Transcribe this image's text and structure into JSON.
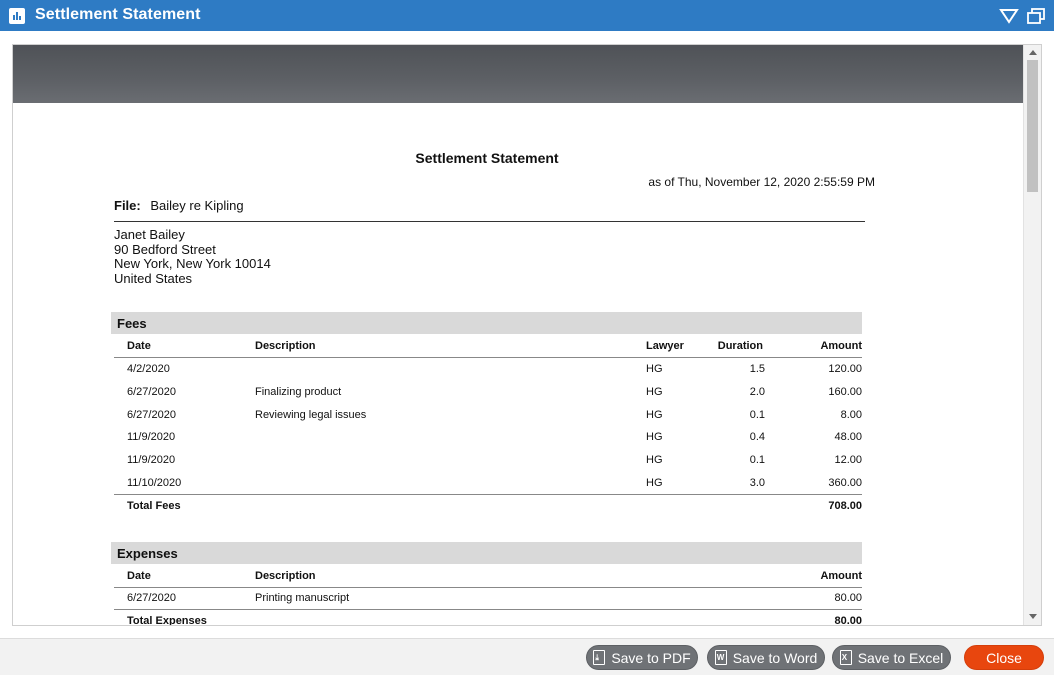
{
  "window": {
    "title": "Settlement Statement"
  },
  "report": {
    "title": "Settlement Statement",
    "as_of": "as of Thu, November 12, 2020  2:55:59 PM",
    "file_label": "File:",
    "file_value": "Bailey re Kipling",
    "address": [
      "Janet Bailey",
      "90 Bedford Street",
      "New York, New York 10014",
      "United States"
    ]
  },
  "fees": {
    "heading": "Fees",
    "columns": {
      "date": "Date",
      "description": "Description",
      "lawyer": "Lawyer",
      "duration": "Duration",
      "amount": "Amount"
    },
    "rows": [
      {
        "date": "4/2/2020",
        "description": "",
        "lawyer": "HG",
        "duration": "1.5",
        "amount": "120.00"
      },
      {
        "date": "6/27/2020",
        "description": "Finalizing product",
        "lawyer": "HG",
        "duration": "2.0",
        "amount": "160.00"
      },
      {
        "date": "6/27/2020",
        "description": "Reviewing legal issues",
        "lawyer": "HG",
        "duration": "0.1",
        "amount": "8.00"
      },
      {
        "date": "11/9/2020",
        "description": "",
        "lawyer": "HG",
        "duration": "0.4",
        "amount": "48.00"
      },
      {
        "date": "11/9/2020",
        "description": "",
        "lawyer": "HG",
        "duration": "0.1",
        "amount": "12.00"
      },
      {
        "date": "11/10/2020",
        "description": "",
        "lawyer": "HG",
        "duration": "3.0",
        "amount": "360.00"
      }
    ],
    "total_label": "Total Fees",
    "total_value": "708.00"
  },
  "expenses": {
    "heading": "Expenses",
    "columns": {
      "date": "Date",
      "description": "Description",
      "amount": "Amount"
    },
    "rows": [
      {
        "date": "6/27/2020",
        "description": "Printing manuscript",
        "amount": "80.00"
      }
    ],
    "total_label": "Total Expenses",
    "total_value": "80.00"
  },
  "footer": {
    "save_pdf": "Save to PDF",
    "save_word": "Save to Word",
    "save_excel": "Save to Excel",
    "close": "Close"
  },
  "icons": {
    "app": "report-chart-icon",
    "collapse": "triangle-down-icon",
    "restore": "restore-window-icon",
    "pdf": "pdf-file-icon",
    "word": "word-file-icon",
    "excel": "excel-file-icon"
  },
  "colors": {
    "titlebar": "#2e7bc4",
    "close_button": "#e8460e",
    "footer_button": "#6f7276"
  }
}
